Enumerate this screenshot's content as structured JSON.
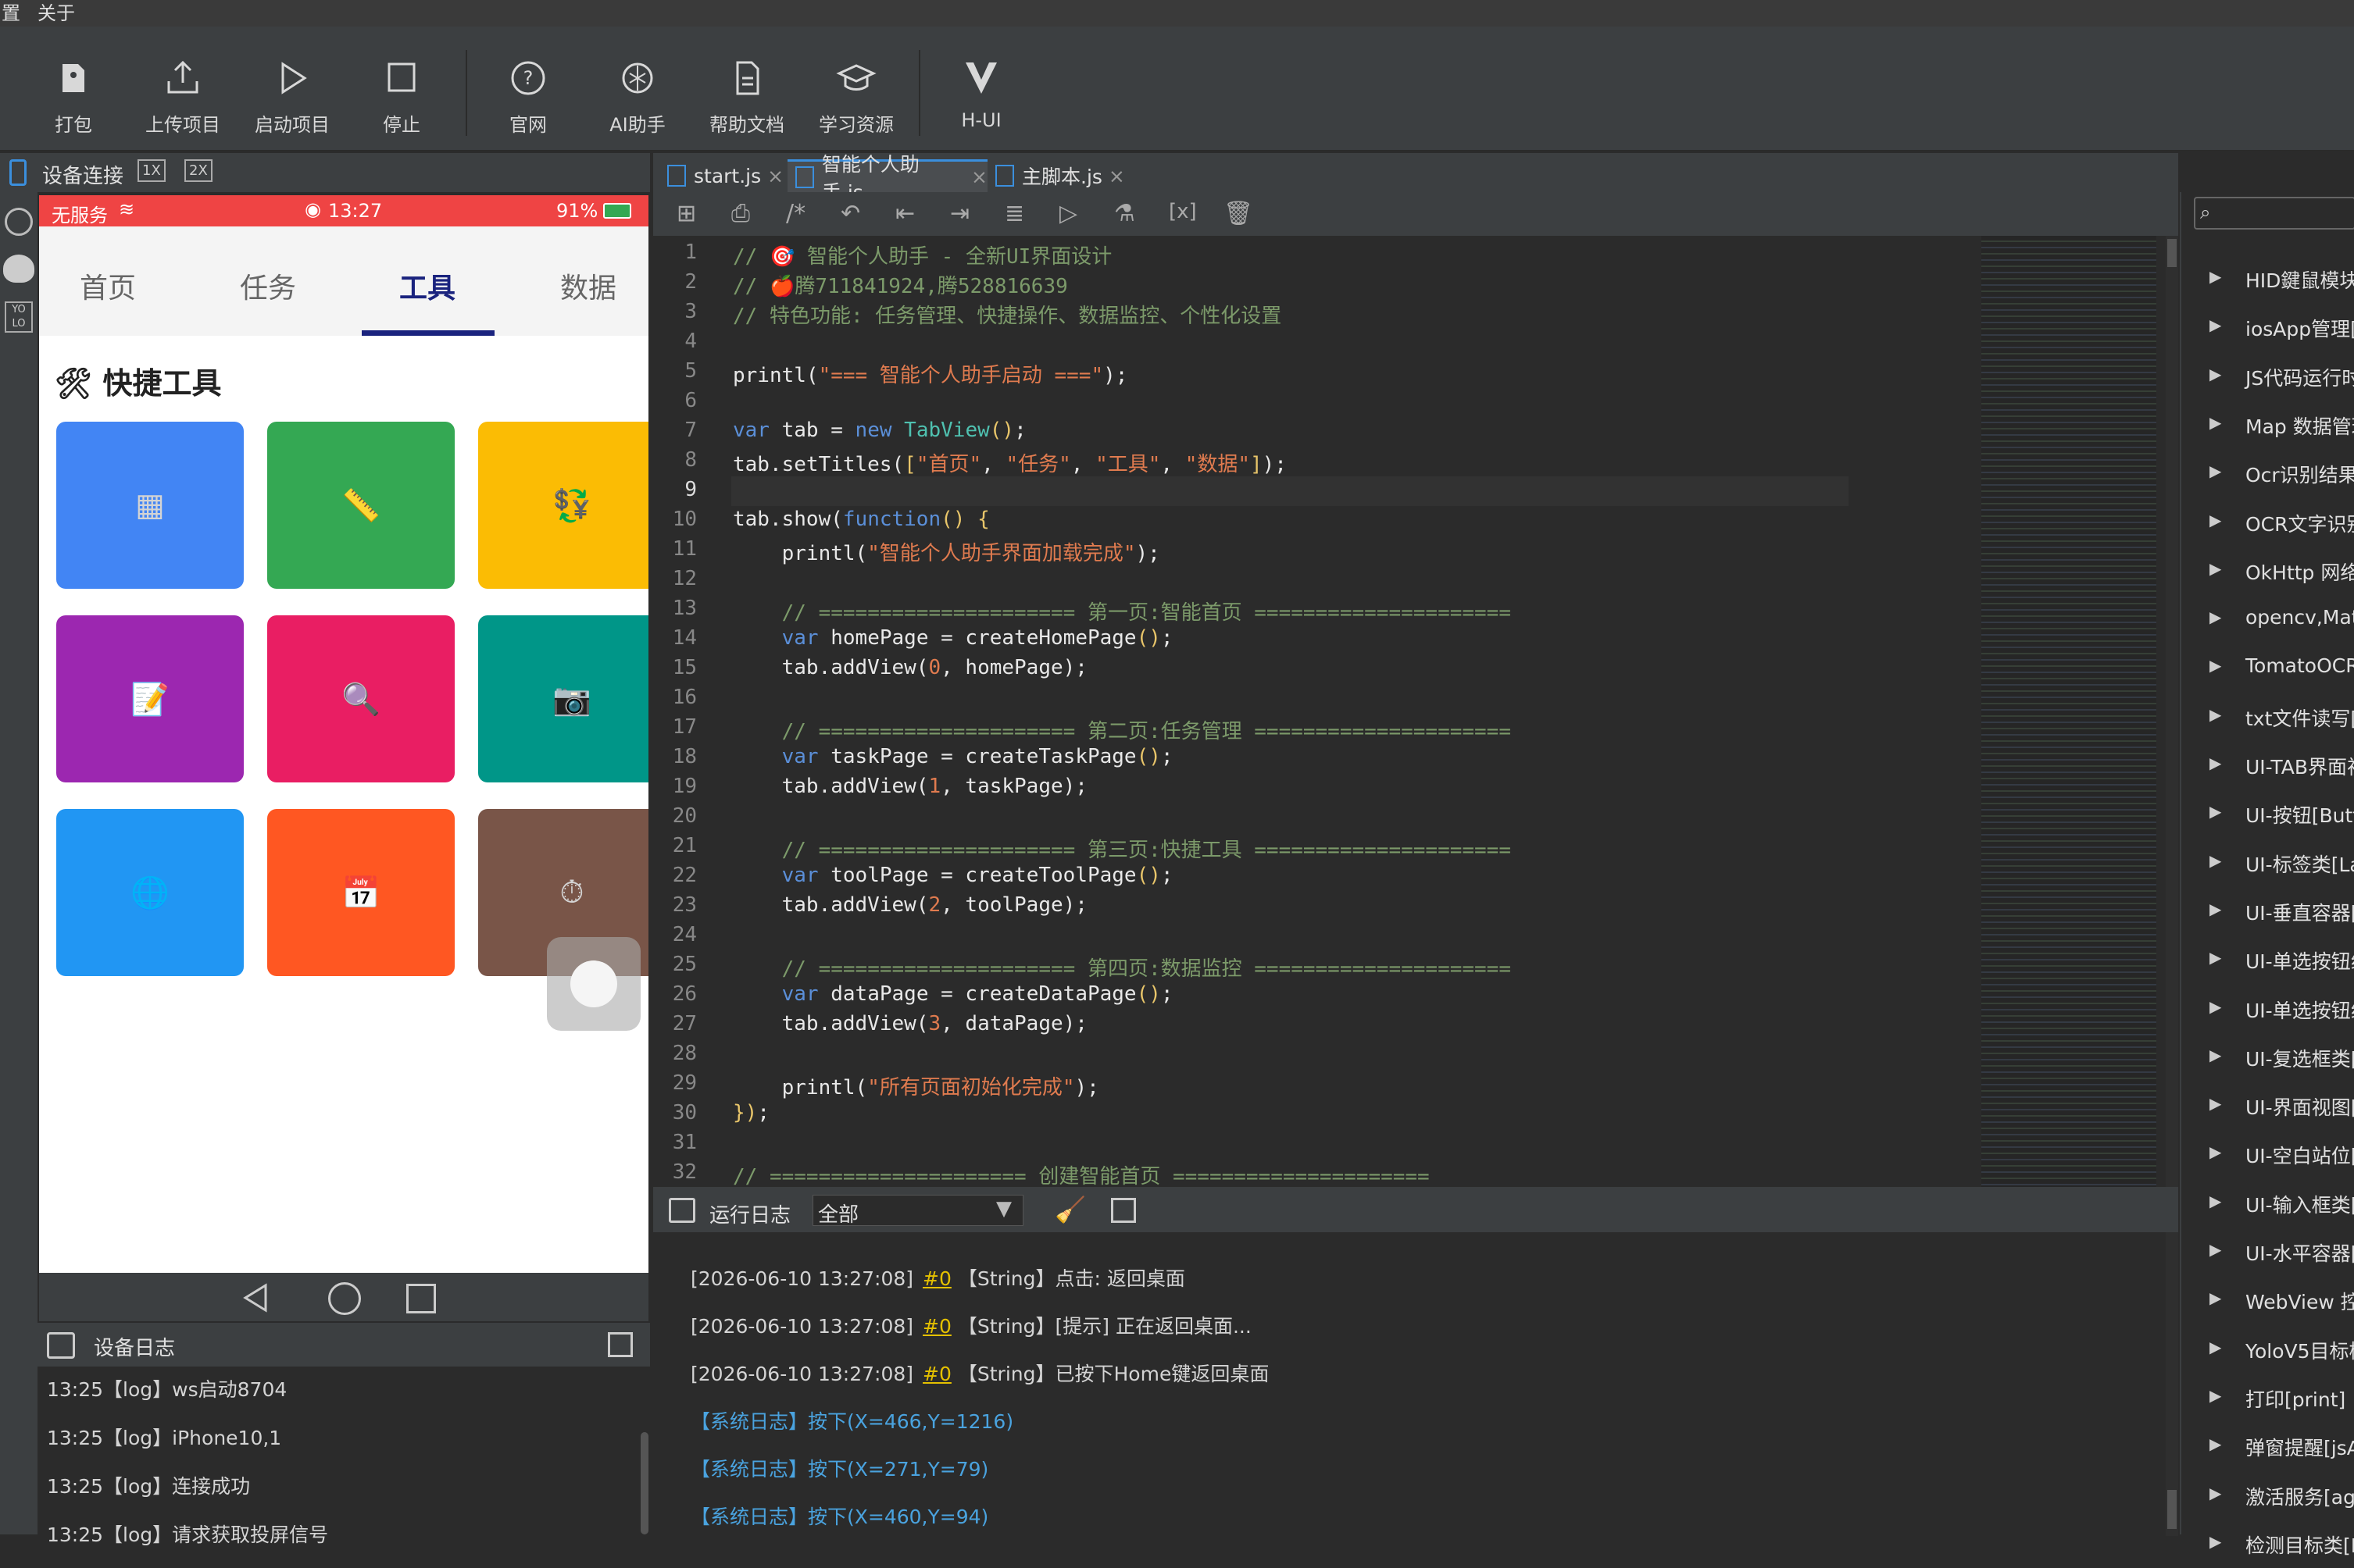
{
  "menubar": {
    "items": [
      "置",
      "关于"
    ]
  },
  "toolbar": {
    "buttons": [
      {
        "label": "打包",
        "icon": "package-icon"
      },
      {
        "label": "上传项目",
        "icon": "upload-icon"
      },
      {
        "label": "启动项目",
        "icon": "play-icon"
      },
      {
        "label": "停止",
        "icon": "stop-icon"
      },
      {
        "label": "官网",
        "icon": "help-circle-icon"
      },
      {
        "label": "AI助手",
        "icon": "ai-icon"
      },
      {
        "label": "帮助文档",
        "icon": "document-icon"
      },
      {
        "label": "学习资源",
        "icon": "graduation-cap-icon"
      },
      {
        "label": "H-UI",
        "icon": "hui-logo-icon"
      }
    ]
  },
  "device": {
    "header_label": "设备连接",
    "scale_1x": "1X",
    "scale_2x": "2X",
    "status": {
      "carrier": "无服务",
      "time": "13:27",
      "battery": "91%"
    },
    "tabs": [
      "首页",
      "任务",
      "工具",
      "数据"
    ],
    "active_tab": 2,
    "section_title": "快捷工具",
    "tiles": [
      {
        "color": "#4285f4",
        "glyph": "▦"
      },
      {
        "color": "#34a853",
        "glyph": "📏"
      },
      {
        "color": "#fbbc04",
        "glyph": "💱"
      },
      {
        "color": "#9c27b0",
        "glyph": "📝"
      },
      {
        "color": "#e91e63",
        "glyph": "🔍"
      },
      {
        "color": "#009688",
        "glyph": "📷"
      },
      {
        "color": "#2196f3",
        "glyph": "🌐"
      },
      {
        "color": "#ff5722",
        "glyph": "📅"
      },
      {
        "color": "#795548",
        "glyph": "⏱"
      }
    ]
  },
  "device_log": {
    "title": "设备日志",
    "lines": [
      "13:25【log】ws启动8704",
      "13:25【log】iPhone10,1",
      "13:25【log】连接成功",
      "13:25【log】请求获取投屏信号"
    ]
  },
  "file_tabs": [
    {
      "name": "start.js",
      "active": false
    },
    {
      "name": "智能个人助手.js",
      "active": true
    },
    {
      "name": "主脚本.js",
      "active": false
    }
  ],
  "code": {
    "line_numbers": [
      "1",
      "2",
      "3",
      "4",
      "5",
      "6",
      "7",
      "8",
      "9",
      "10",
      "11",
      "12",
      "13",
      "14",
      "15",
      "16",
      "17",
      "18",
      "19",
      "20",
      "21",
      "22",
      "23",
      "24",
      "25",
      "26",
      "27",
      "28",
      "29",
      "30",
      "31",
      "32"
    ],
    "current_line": 9
  },
  "run_log": {
    "title": "运行日志",
    "filter": "全部",
    "lines": [
      {
        "time": "[2026-06-10 13:27:08]",
        "tag": "#0",
        "text": "【String】点击: 返回桌面",
        "type": "normal"
      },
      {
        "time": "[2026-06-10 13:27:08]",
        "tag": "#0",
        "text": "【String】[提示] 正在返回桌面...",
        "type": "normal"
      },
      {
        "time": "[2026-06-10 13:27:08]",
        "tag": "#0",
        "text": "【String】已按下Home键返回桌面",
        "type": "normal"
      },
      {
        "time": "",
        "tag": "",
        "text": "【系统日志】按下(X=466,Y=1216)",
        "type": "system"
      },
      {
        "time": "",
        "tag": "",
        "text": "【系统日志】按下(X=271,Y=79)",
        "type": "system"
      },
      {
        "time": "",
        "tag": "",
        "text": "【系统日志】按下(X=460,Y=94)",
        "type": "system"
      }
    ]
  },
  "api_tree": {
    "items": [
      "HID鍵鼠模块",
      "iosApp管理[",
      "JS代码运行时",
      "Map 数据管理",
      "Ocr识别结果",
      "OCR文字识别",
      "OkHttp 网络",
      "opencv,Mat",
      "TomatoOCR",
      "txt文件读写[",
      "UI-TAB界面视",
      "UI-按钮[Butt",
      "UI-标签类[La",
      "UI-垂直容器[",
      "UI-单选按钮组",
      "UI-单选按钮组",
      "UI-复选框类[",
      "UI-界面视图[",
      "UI-空白站位[",
      "UI-输入框类[",
      "UI-水平容器[",
      "WebView 控",
      "YoloV5目标检",
      "打印[print]",
      "弹窗提醒[jsA",
      "激活服务[age",
      "检测目标类[D"
    ]
  },
  "colors": {
    "accent_blue": "#1565c0",
    "status_red": "#ef4444",
    "log_blue": "#4aa3df",
    "log_tag": "#e5c100"
  }
}
